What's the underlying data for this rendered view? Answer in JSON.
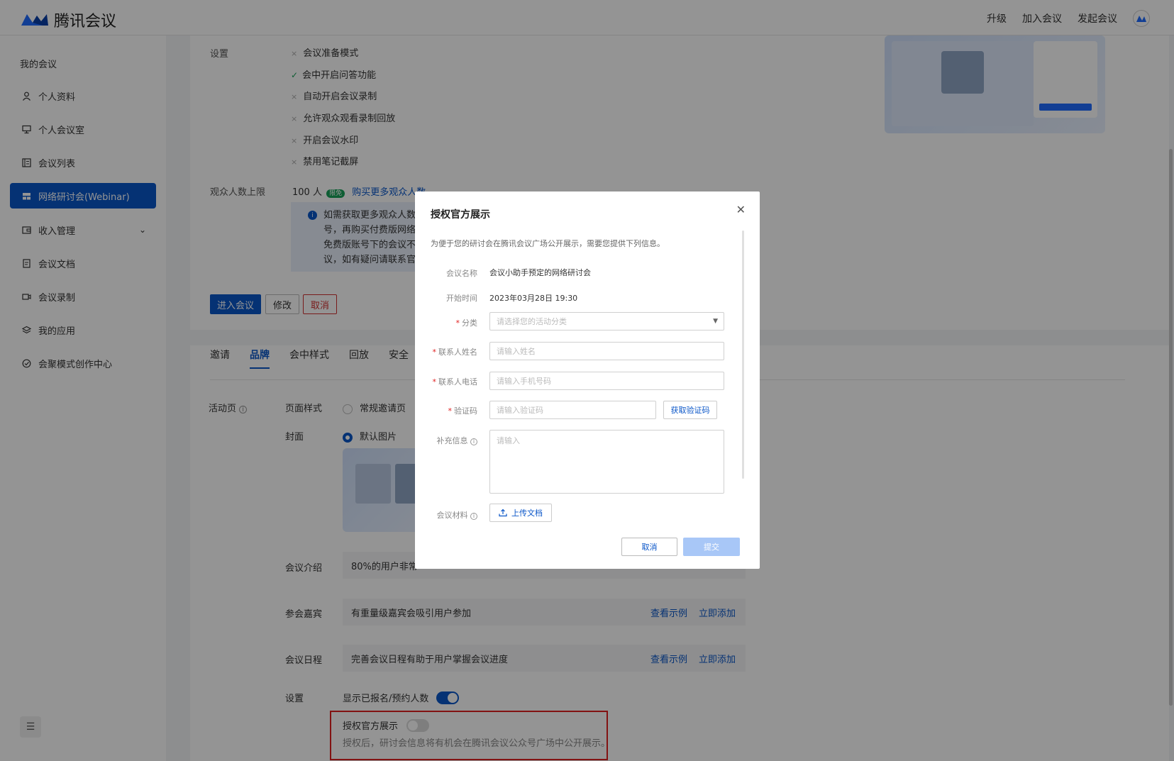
{
  "header": {
    "app_name": "腾讯会议",
    "nav": [
      "升级",
      "加入会议",
      "发起会议"
    ],
    "brand_color": "#0a56c8"
  },
  "sidebar": {
    "title": "我的会议",
    "items": [
      {
        "label": "个人资料",
        "icon": "user-icon"
      },
      {
        "label": "个人会议室",
        "icon": "monitor-icon"
      },
      {
        "label": "会议列表",
        "icon": "list-icon"
      },
      {
        "label": "网络研讨会(Webinar)",
        "icon": "webinar-icon",
        "active": true
      },
      {
        "label": "收入管理",
        "icon": "wallet-icon",
        "expandable": true
      },
      {
        "label": "会议文档",
        "icon": "document-icon"
      },
      {
        "label": "会议录制",
        "icon": "camera-icon"
      },
      {
        "label": "我的应用",
        "icon": "layers-icon"
      },
      {
        "label": "会聚模式创作中心",
        "icon": "check-circle-icon"
      }
    ]
  },
  "settings": {
    "label": "设置",
    "options": [
      {
        "text": "会议准备模式",
        "enabled": false
      },
      {
        "text": "会中开启问答功能",
        "enabled": true
      },
      {
        "text": "自动开启会议录制",
        "enabled": false
      },
      {
        "text": "允许观众观看录制回放",
        "enabled": false
      },
      {
        "text": "开启会议水印",
        "enabled": false
      },
      {
        "text": "禁用笔记截屏",
        "enabled": false
      }
    ],
    "audience_label": "观众人数上限",
    "audience_value": "100 人",
    "audience_badge": "限免",
    "audience_link": "购买更多观众人数",
    "info_lines": [
      "如需获取更多观众人数",
      "号，再购买付费版网络",
      "免费版账号下的会议不",
      "议，如有疑问请联系官"
    ],
    "buttons": {
      "enter": "进入会议",
      "edit": "修改",
      "cancel": "取消"
    }
  },
  "tabs": [
    "邀请",
    "品牌",
    "会中样式",
    "回放",
    "安全"
  ],
  "brand": {
    "activity_label": "活动页",
    "page_style_label": "页面样式",
    "page_style_option": "常规邀请页",
    "cover_label": "封面",
    "cover_option": "默认图片",
    "intro_label": "会议介绍",
    "intro_text": "80%的用户非常",
    "guests_label": "参会嘉宾",
    "guests_text": "有重量级嘉宾会吸引用户参加",
    "agenda_label": "会议日程",
    "agenda_text": "完善会议日程有助于用户掌握会议进度",
    "view_example": "查看示例",
    "add_now": "立即添加",
    "setting_label": "设置",
    "show_count_label": "显示已报名/预约人数",
    "show_count_on": true,
    "auth_label": "授权官方展示",
    "auth_on": false,
    "auth_desc": "授权后，研讨会信息将有机会在腾讯会议公众号广场中公开展示。"
  },
  "modal": {
    "title": "授权官方展示",
    "subtitle": "为便于您的研讨会在腾讯会议广场公开展示，需要您提供下列信息。",
    "name_label": "会议名称",
    "name_value": "会议小助手预定的网络研讨会",
    "time_label": "开始时间",
    "time_value": "2023年03月28日 19:30",
    "category_label": "分类",
    "category_placeholder": "请选择您的活动分类",
    "contact_name_label": "联系人姓名",
    "contact_name_placeholder": "请输入姓名",
    "contact_phone_label": "联系人电话",
    "contact_phone_placeholder": "请输入手机号码",
    "code_label": "验证码",
    "code_placeholder": "请输入验证码",
    "get_code": "获取验证码",
    "extra_label": "补充信息",
    "extra_placeholder": "请输入",
    "material_label": "会议材料",
    "upload_label": "上传文档",
    "cancel": "取消",
    "submit": "提交"
  }
}
